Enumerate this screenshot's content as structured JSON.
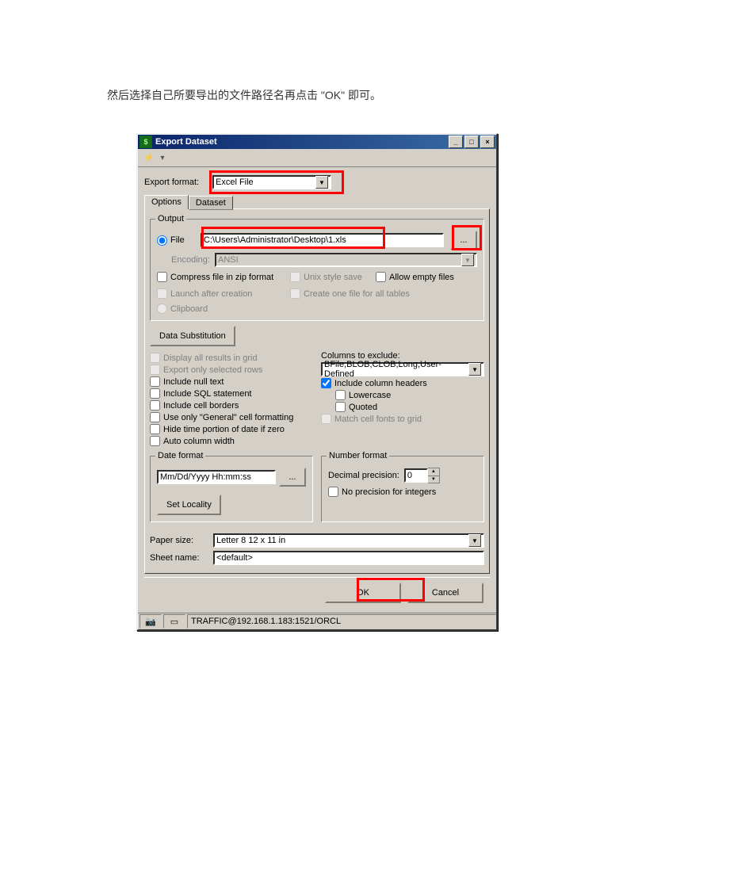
{
  "intro_text": "然后选择自己所要导出的文件路径名再点击 \"OK\" 即可。",
  "window": {
    "title": "Export Dataset",
    "export_format_label": "Export format:",
    "export_format_value": "Excel File",
    "tabs": {
      "options": "Options",
      "dataset": "Dataset"
    },
    "output": {
      "legend": "Output",
      "file_radio": "File",
      "file_path": "C:\\Users\\Administrator\\Desktop\\1.xls",
      "encoding_label": "Encoding:",
      "encoding_value": "ANSI",
      "compress": "Compress file in zip format",
      "unix_save": "Unix style save",
      "allow_empty": "Allow empty files",
      "launch": "Launch after creation",
      "create_one": "Create one file for all tables",
      "clipboard": "Clipboard"
    },
    "data_sub_btn": "Data Substitution",
    "left_checks": {
      "display_all": "Display all results in grid",
      "export_sel": "Export only selected rows",
      "include_null": "Include null text",
      "include_sql": "Include SQL statement",
      "include_borders": "Include cell borders",
      "use_general": "Use only \"General\" cell formatting",
      "hide_time": "Hide time portion of date if zero",
      "auto_width": "Auto column width"
    },
    "right_col": {
      "cols_exclude_label": "Columns to exclude:",
      "cols_exclude_value": "BFile,BLOB,CLOB,Long,User-Defined",
      "include_headers": "Include column headers",
      "lowercase": "Lowercase",
      "quoted": "Quoted",
      "match_fonts": "Match cell fonts to grid"
    },
    "date_format": {
      "legend": "Date format",
      "value": "Mm/Dd/Yyyy Hh:mm:ss",
      "set_locality": "Set Locality"
    },
    "number_format": {
      "legend": "Number format",
      "decimal_label": "Decimal precision:",
      "decimal_value": "0",
      "no_precision": "No precision for integers"
    },
    "paper_size_label": "Paper size:",
    "paper_size_value": "Letter 8 12 x 11 in",
    "sheet_name_label": "Sheet name:",
    "sheet_name_value": "<default>",
    "ok": "OK",
    "cancel": "Cancel",
    "status": "TRAFFIC@192.168.1.183:1521/ORCL"
  }
}
